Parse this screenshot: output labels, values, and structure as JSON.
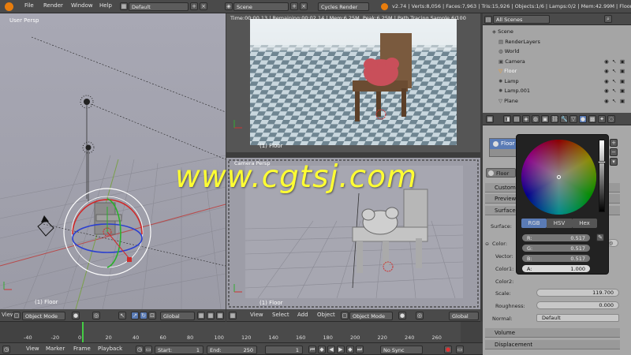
{
  "topbar": {
    "menus": [
      "File",
      "Render",
      "Window",
      "Help"
    ],
    "screen_layout": "Default",
    "scene": "Scene",
    "render_engine": "Cycles Render",
    "stats": "v2.74 | Verts:8,056 | Faces:7,963 | Tris:15,926 | Objects:1/6 | Lamps:0/2 | Mem:42.99M | Floor"
  },
  "viewport_left": {
    "title": "User Persp",
    "object_label": "(1) Floor",
    "header": {
      "menu": "View",
      "mode": "Object Mode",
      "orientation": "Global"
    }
  },
  "render_view": {
    "status": "Time:00:00.13 | Remaining:00:02.14 | Mem:6.25M, Peak:6.25M | Path Tracing Sample 6/100",
    "object_label": "(1) Floor"
  },
  "camera_view": {
    "title": "Camera Persp",
    "object_label": "(1) Floor",
    "header": {
      "menus": [
        "View",
        "Select",
        "Add",
        "Object"
      ],
      "mode": "Object Mode",
      "orientation": "Global"
    }
  },
  "watermark": "www.cgtsj.com",
  "outliner": {
    "search": "All Scenes",
    "rows": [
      {
        "label": "Scene",
        "indent": 0
      },
      {
        "label": "RenderLayers",
        "indent": 1
      },
      {
        "label": "World",
        "indent": 1
      },
      {
        "label": "Camera",
        "indent": 1
      },
      {
        "label": "Floor",
        "indent": 1
      },
      {
        "label": "Lamp",
        "indent": 1
      },
      {
        "label": "Lamp.001",
        "indent": 1
      },
      {
        "label": "Plane",
        "indent": 1
      }
    ]
  },
  "properties": {
    "material_slot": "Floor",
    "material_name": "Floor",
    "panels": [
      "Custom",
      "Preview",
      "Surface"
    ],
    "surface_label": "Surface:",
    "rows": [
      {
        "label": "Color:"
      },
      {
        "label": "Vector:"
      },
      {
        "label": "Color1:"
      },
      {
        "label": "Color2:"
      }
    ],
    "scale_label": "Scale:",
    "scale_value": "119.700",
    "roughness_label": "Roughness:",
    "roughness_value": "0.000",
    "normal_label": "Normal:",
    "normal_value": "Default",
    "bottom_panels": [
      "Volume",
      "Displacement"
    ]
  },
  "color_picker": {
    "tabs": [
      "RGB",
      "HSV",
      "Hex"
    ],
    "active_tab": "RGB",
    "channels": [
      {
        "label": "R:",
        "value": "0.517"
      },
      {
        "label": "G:",
        "value": "0.517"
      },
      {
        "label": "B:",
        "value": "0.517"
      },
      {
        "label": "A:",
        "value": "1.000"
      }
    ]
  },
  "timeline": {
    "ticks": [
      "-40",
      "-20",
      "0",
      "20",
      "40",
      "60",
      "80",
      "100",
      "120",
      "140",
      "160",
      "180",
      "200",
      "220",
      "240",
      "260"
    ],
    "menus": [
      "View",
      "Marker",
      "Frame",
      "Playback"
    ],
    "start_label": "Start:",
    "start_value": "1",
    "end_label": "End:",
    "end_value": "250",
    "current_frame": "1",
    "sync": "No Sync"
  }
}
